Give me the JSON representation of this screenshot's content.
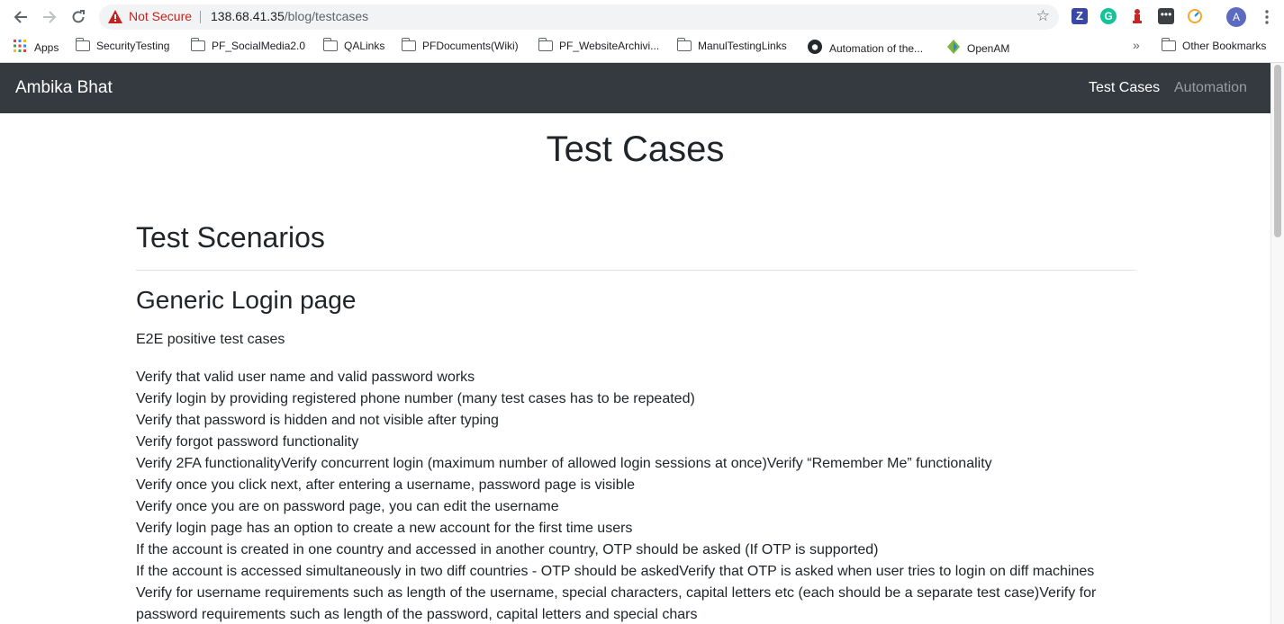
{
  "browser": {
    "security_label": "Not Secure",
    "url_host": "138.68.41.35",
    "url_path": "/blog/testcases",
    "profile_initial": "A"
  },
  "bookmarks": {
    "apps": "Apps",
    "items": [
      "SecurityTesting",
      "PF_SocialMedia2.0",
      "QALinks",
      "PFDocuments(Wiki)",
      "PF_WebsiteArchivi...",
      "ManulTestingLinks",
      "Automation of the...",
      "OpenAM"
    ],
    "overflow": "»",
    "other": "Other Bookmarks"
  },
  "site": {
    "brand": "Ambika Bhat",
    "nav": [
      "Test Cases",
      "Automation"
    ]
  },
  "content": {
    "title": "Test Cases",
    "section": "Test Scenarios",
    "subsection": "Generic Login page",
    "intro": "E2E positive test cases",
    "cases": [
      "Verify that valid user name and valid password works",
      "Verify login by providing registered phone number (many test cases has to be repeated)",
      "Verify that password is hidden and not visible after typing",
      "Verify forgot password functionality",
      "Verify 2FA functionalityVerify concurrent login (maximum number of allowed login sessions at once)Verify “Remember Me” functionality",
      "Verify once you click next, after entering a username, password page is visible",
      "Verify once you are on password page, you can edit the username",
      "Verify login page has an option to create a new account for the first time users",
      "If the account is created in one country and accessed in another country, OTP should be asked (If OTP is supported)",
      "If the account is accessed simultaneously in two diff countries - OTP should be askedVerify that OTP is asked when user tries to login on diff machines",
      "Verify for username requirements such as length of the username, special characters, capital letters etc (each should be a separate test case)Verify for password requirements such as length of the password, capital letters and special chars"
    ]
  },
  "colors": {
    "navbar": "#343a40",
    "nav_active": "#ffffff",
    "nav_inactive": "#9a9da0",
    "warning": "#c5221f"
  }
}
